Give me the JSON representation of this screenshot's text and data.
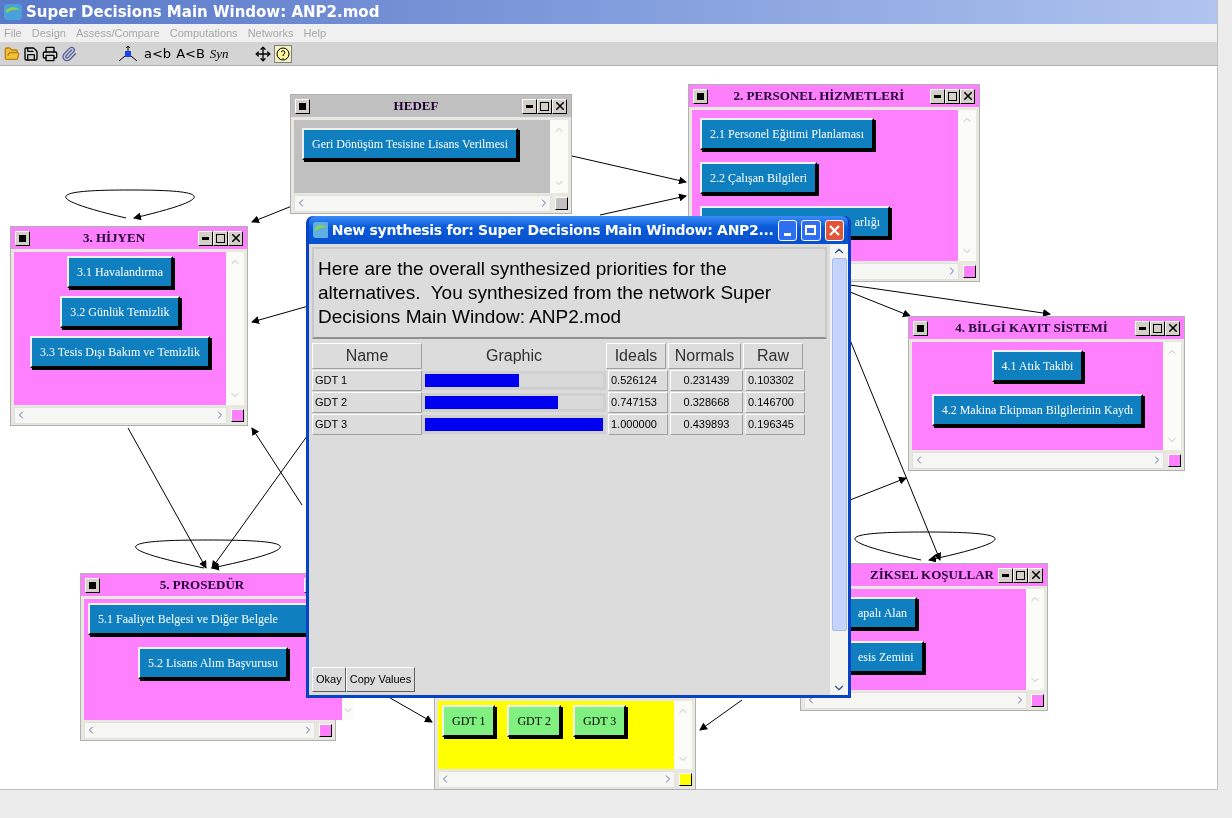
{
  "window": {
    "title": "Super Decisions Main Window: ANP2.mod"
  },
  "menu": [
    "File",
    "Design",
    "Assess/Compare",
    "Computations",
    "Networks",
    "Help"
  ],
  "toolbar": {
    "text_tools": [
      "a<b",
      "A<B",
      "Syn"
    ]
  },
  "clusters": [
    {
      "title": "HEDEF",
      "kind": "goal",
      "color": "#c0c0c0",
      "nodes": [
        {
          "label": "Geri Dönüşüm Tesisine Lisans Verilmesi"
        }
      ]
    },
    {
      "title": "2. PERSONEL HİZMETLERİ",
      "kind": "criteria",
      "color": "#ff80ff",
      "nodes": [
        {
          "label": "2.1 Personel Eğitimi Planlaması"
        },
        {
          "label": "2.2 Çalışan Bilgileri"
        },
        {
          "label": "arlığı"
        }
      ]
    },
    {
      "title": "3. HİJYEN",
      "kind": "criteria",
      "color": "#ff80ff",
      "nodes": [
        {
          "label": "3.1 Havalandırma"
        },
        {
          "label": "3.2 Günlük Temizlik"
        },
        {
          "label": "3.3 Tesis Dışı Bakım ve Temizlik"
        }
      ]
    },
    {
      "title": "4. BİLGİ KAYIT SİSTEMİ",
      "kind": "criteria",
      "color": "#ff80ff",
      "nodes": [
        {
          "label": "4.1 Atık Takibi"
        },
        {
          "label": "4.2 Makina Ekipman Bilgilerinin Kaydı"
        }
      ]
    },
    {
      "title": "5. PROSEDÜR",
      "kind": "criteria",
      "color": "#ff80ff",
      "nodes": [
        {
          "label": "5.1 Faaliyet Belgesi ve Diğer Belgele"
        },
        {
          "label": "5.2 Lisans Alım Başvurusu"
        }
      ]
    },
    {
      "title": "ZİKSEL KOŞULLAR",
      "kind": "criteria",
      "color": "#ff80ff",
      "nodes": [
        {
          "label": "apalı Alan"
        },
        {
          "label": "esis Zemini"
        }
      ]
    },
    {
      "kind": "alternatives",
      "color": "#ffff00",
      "nodes": [
        {
          "label": "GDT 1"
        },
        {
          "label": "GDT 2"
        },
        {
          "label": "GDT 3"
        }
      ]
    }
  ],
  "dialog": {
    "title": "New synthesis for: Super Decisions Main Window: ANP2...",
    "message": "Here are the overall synthesized priorities for the alternatives.  You synthesized from the network Super Decisions Main Window: ANP2.mod",
    "columns": [
      "Name",
      "Graphic",
      "Ideals",
      "Normals",
      "Raw"
    ],
    "rows": [
      {
        "name": "GDT 1",
        "level": 0.526124,
        "ideals": "0.526124",
        "normals": "0.231439",
        "raw": "0.103302"
      },
      {
        "name": "GDT 2",
        "level": 0.747153,
        "ideals": "0.747153",
        "normals": "0.328668",
        "raw": "0.146700"
      },
      {
        "name": "GDT 3",
        "level": 1.0,
        "ideals": "1.000000",
        "normals": "0.439893",
        "raw": "0.196345"
      }
    ],
    "buttons": [
      "Okay",
      "Copy Values"
    ]
  }
}
